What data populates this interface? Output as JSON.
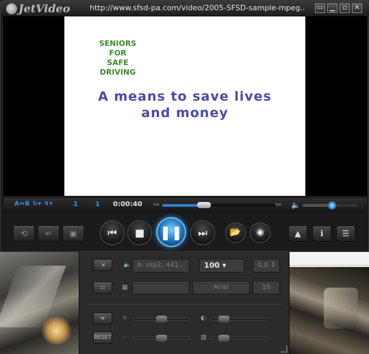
{
  "app": {
    "name": "JetVideo",
    "url": "http://www.sfsd-pa.com/video/2005-SFSD-sample-mpeg..."
  },
  "window_controls": {
    "minimize": "▁",
    "restore": "▫",
    "close": "✕",
    "pin": "▭"
  },
  "video": {
    "seniors_lines": [
      "SENIORS",
      "FOR",
      "SAFE",
      "DRIVING"
    ],
    "tagline_1": "A means to save lives",
    "tagline_2": "and money"
  },
  "status": {
    "ab_label": "A↔B",
    "loop_label": "↻▾",
    "speed_label": "↯▾",
    "chapter": "1",
    "title_num": "1",
    "time": "0:00:40",
    "seek_fraction": 0.35,
    "volume_fraction": 0.55
  },
  "panel": {
    "audio_track": "A: mp2, 441...",
    "volume": "100",
    "audio_delay": "0.0",
    "subtitle_field": "",
    "font": "Arial",
    "font_size": "16",
    "reset_label": "RESET",
    "brightness_fraction": 0.5,
    "contrast_fraction": 0.15,
    "saturation_fraction": 0.5,
    "hue_fraction": 0.15
  },
  "colors": {
    "accent": "#2d7fd0",
    "seniors_text": "#3a8a2a",
    "tagline_text": "#4a4aa8"
  }
}
